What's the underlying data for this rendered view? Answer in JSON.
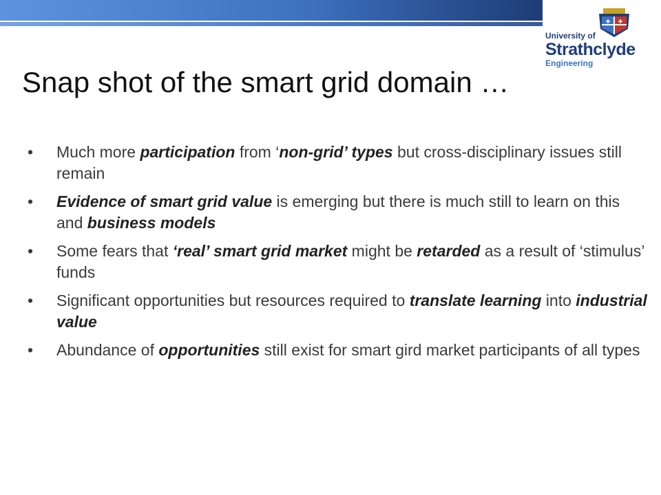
{
  "slide": {
    "title": "Snap shot of the smart grid domain …"
  },
  "logo": {
    "line1": "University of",
    "line2": "Strathclyde",
    "line3": "Engineering",
    "colors": {
      "navy": "#1f3f7a",
      "blue": "#3e73c2",
      "red": "#c0392b"
    }
  },
  "bullets": [
    [
      {
        "t": "Much more ",
        "e": false
      },
      {
        "t": "participation",
        "e": true
      },
      {
        "t": " from ‘",
        "e": false
      },
      {
        "t": "non-grid’ types",
        "e": true
      },
      {
        "t": " but  cross-disciplinary issues still remain",
        "e": false
      }
    ],
    [
      {
        "t": "Evidence of smart grid value",
        "e": true
      },
      {
        "t": " is emerging but there is much still to learn on this and ",
        "e": false
      },
      {
        "t": "business models",
        "e": true
      }
    ],
    [
      {
        "t": "Some fears that ",
        "e": false
      },
      {
        "t": "‘real’ smart grid market",
        "e": true
      },
      {
        "t": " might be ",
        "e": false
      },
      {
        "t": "retarded",
        "e": true
      },
      {
        "t": " as a result of ‘stimulus’ funds",
        "e": false
      }
    ],
    [
      {
        "t": "Significant opportunities but resources required to ",
        "e": false
      },
      {
        "t": "translate learning",
        "e": true
      },
      {
        "t": " into ",
        "e": false
      },
      {
        "t": "industrial value",
        "e": true
      }
    ],
    [
      {
        "t": "Abundance of ",
        "e": false
      },
      {
        "t": "opportunities",
        "e": true
      },
      {
        "t": " still exist for smart gird market participants of all types",
        "e": false
      }
    ]
  ],
  "bullet_symbol": "•"
}
